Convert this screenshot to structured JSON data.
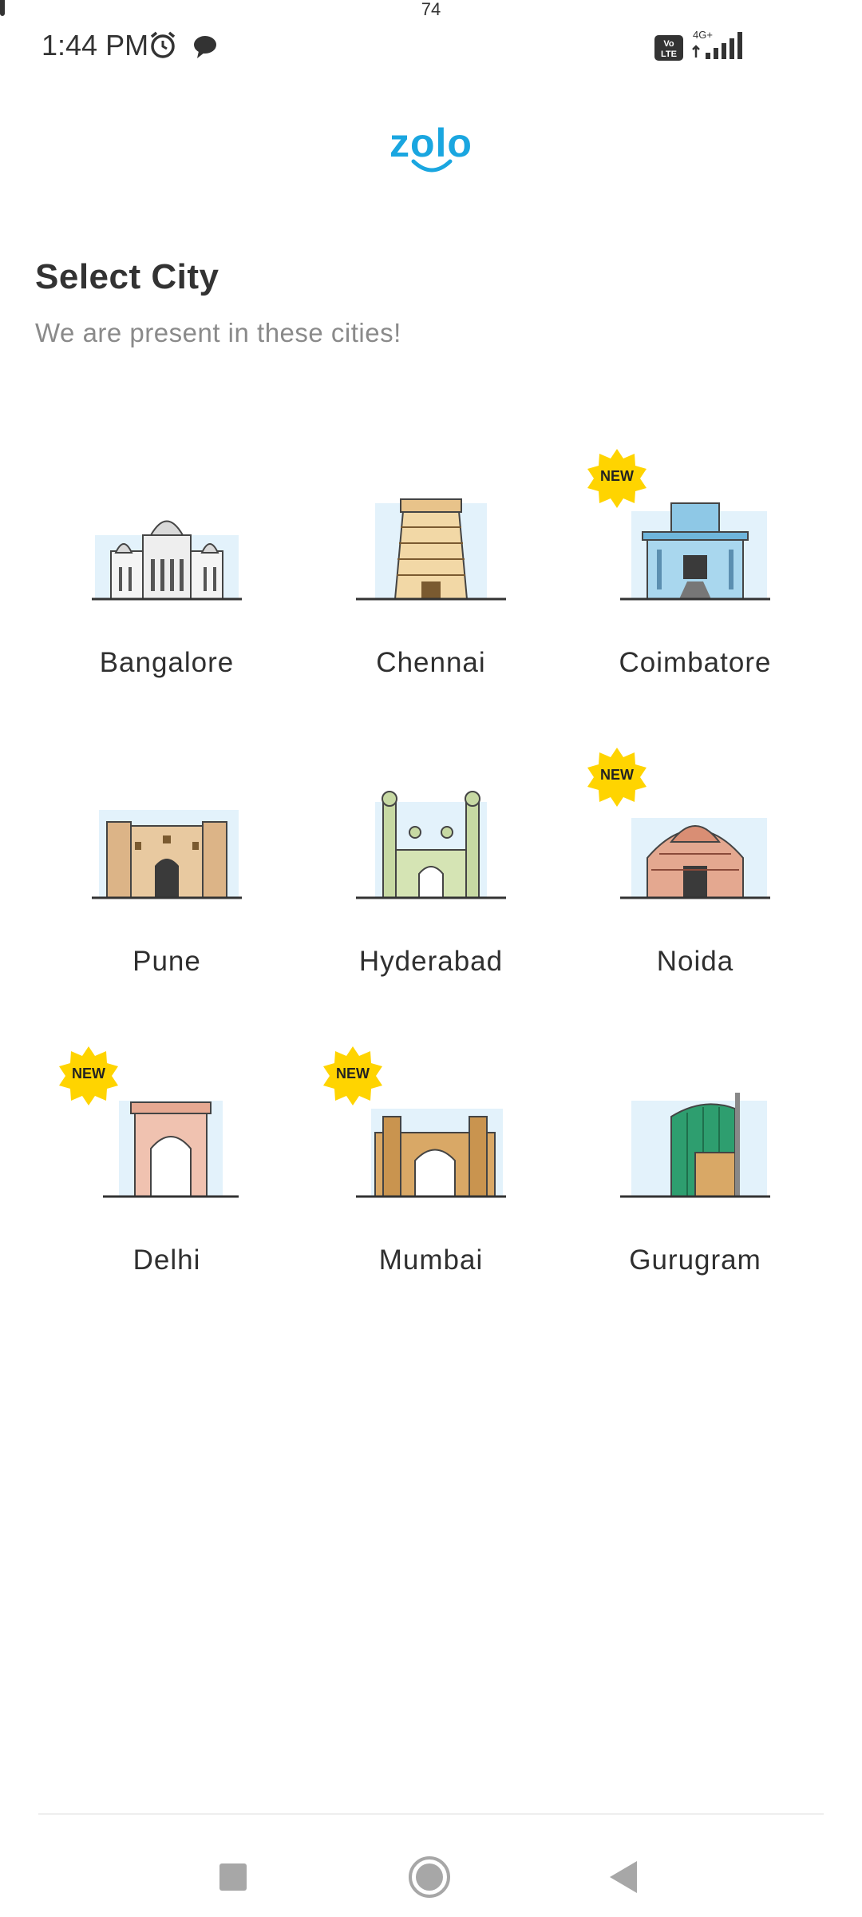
{
  "status_bar": {
    "time": "1:44 PM",
    "battery": "74",
    "network": "4G+",
    "icons": [
      "alarm-icon",
      "chat-icon",
      "volte-icon",
      "signal-icon",
      "battery-icon"
    ]
  },
  "logo": {
    "text": "zolo"
  },
  "header": {
    "title": "Select City",
    "subtitle": "We are present in these cities!"
  },
  "badge_label": "NEW",
  "cities": [
    {
      "name": "Bangalore",
      "new": false
    },
    {
      "name": "Chennai",
      "new": false
    },
    {
      "name": "Coimbatore",
      "new": true
    },
    {
      "name": "Pune",
      "new": false
    },
    {
      "name": "Hyderabad",
      "new": false
    },
    {
      "name": "Noida",
      "new": true
    },
    {
      "name": "Delhi",
      "new": true
    },
    {
      "name": "Mumbai",
      "new": true
    },
    {
      "name": "Gurugram",
      "new": false
    }
  ],
  "colors": {
    "brand": "#1aa6e0",
    "badge": "#ffd400"
  },
  "nav": {
    "icons": [
      "recent-apps-icon",
      "home-icon",
      "back-icon"
    ]
  }
}
